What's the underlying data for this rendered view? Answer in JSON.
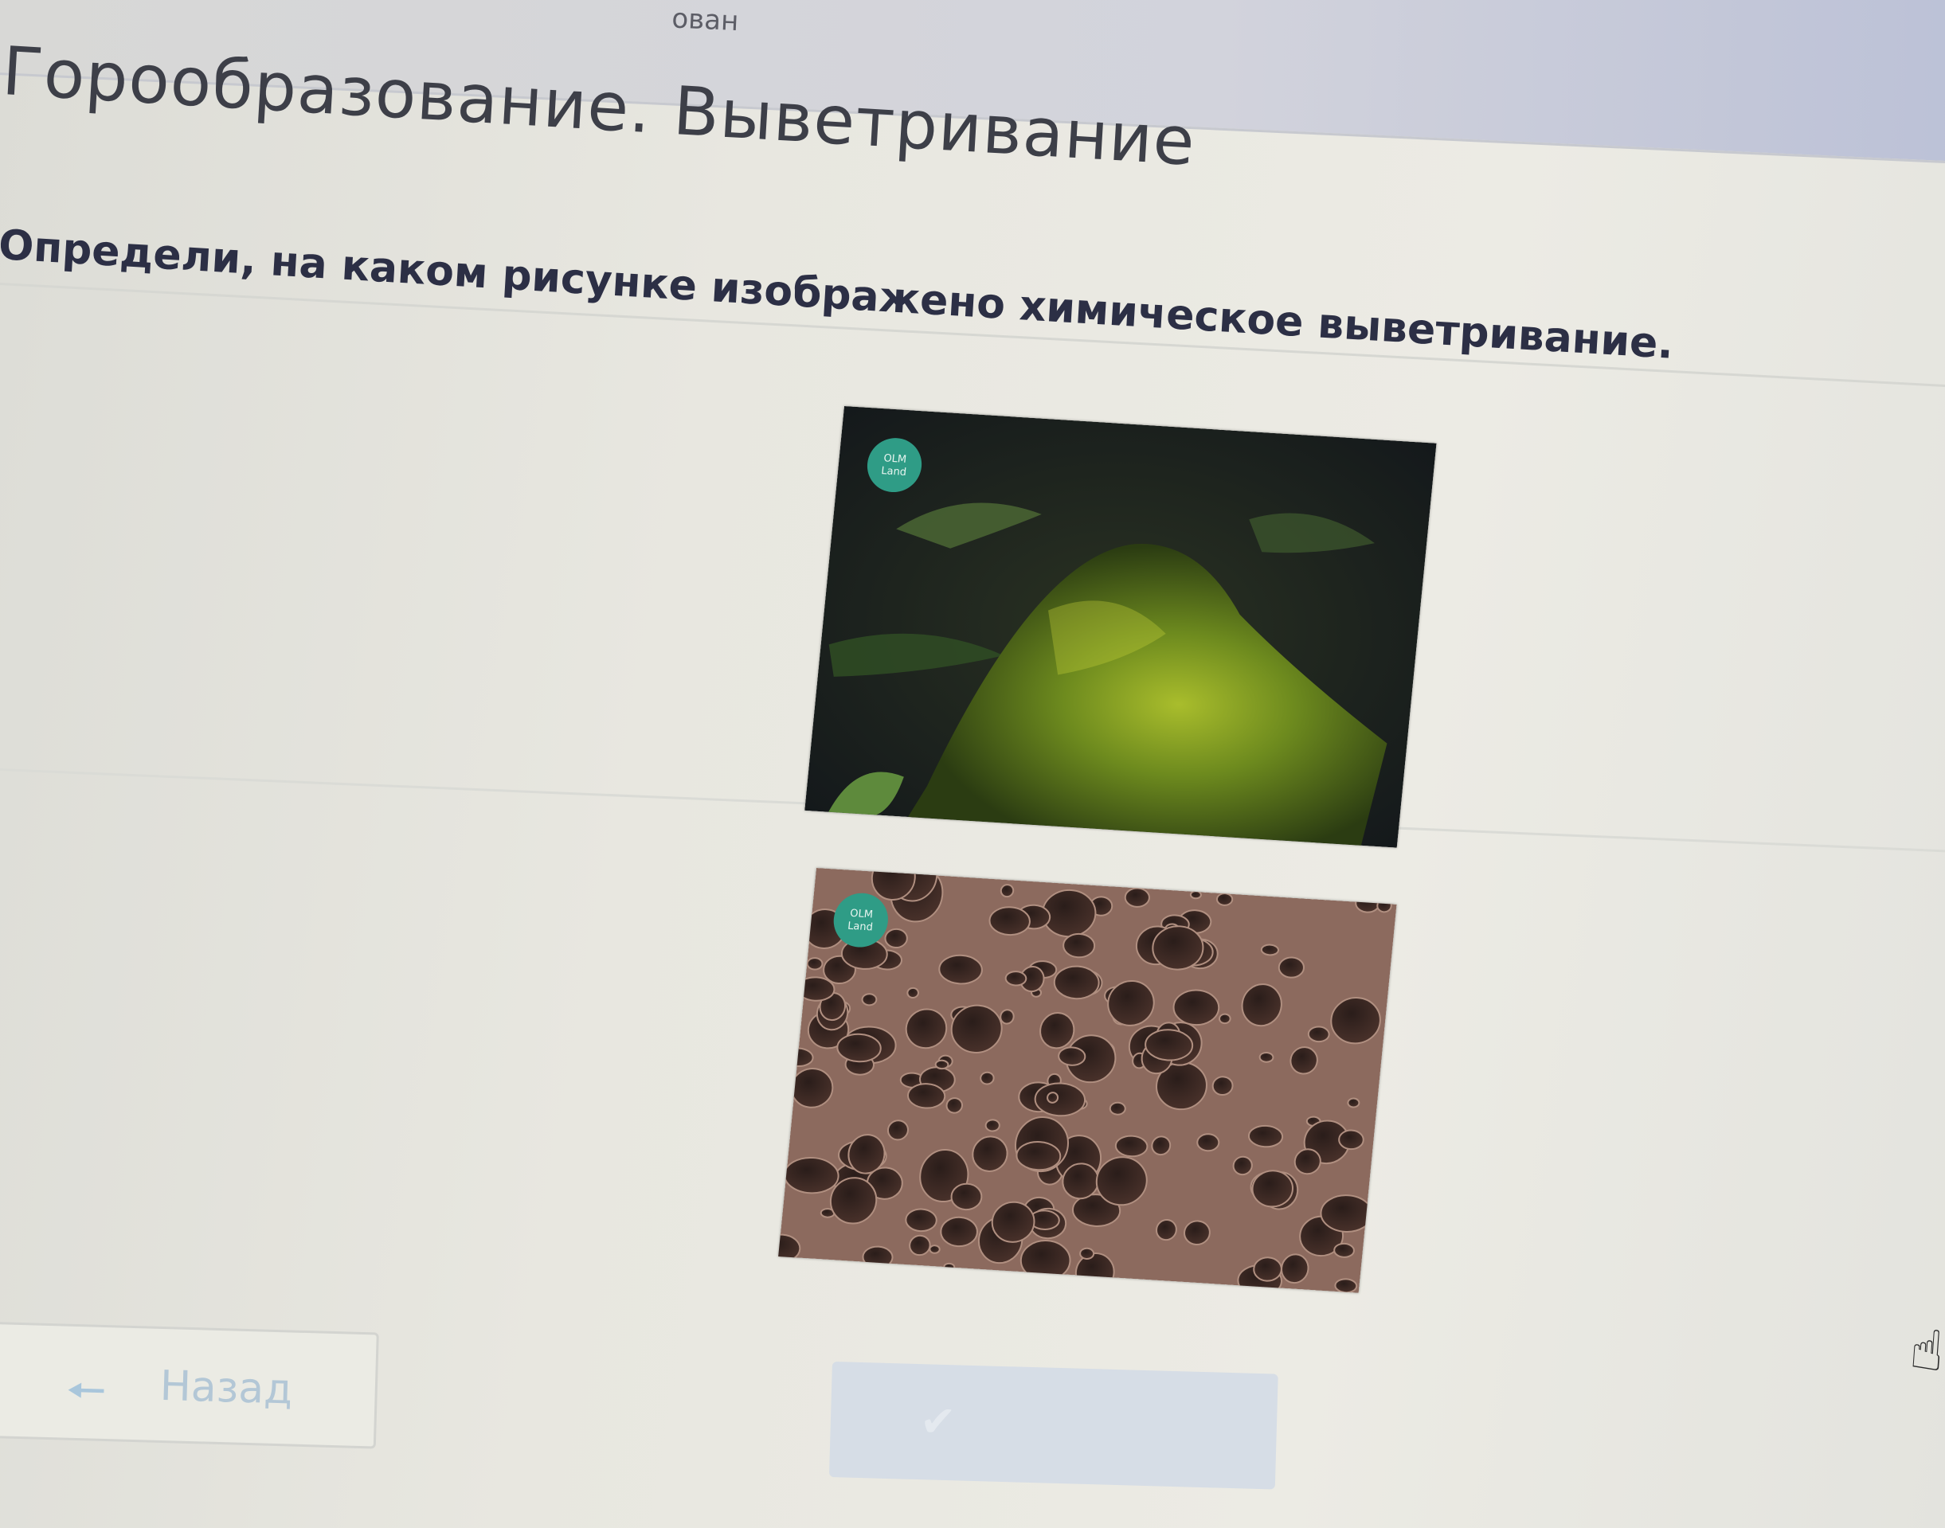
{
  "header": {
    "partial_text": "ован"
  },
  "lesson": {
    "title": "Горообразование. Выветривание"
  },
  "question": {
    "text": "Определи, на каком рисунке изображено химическое выветривание."
  },
  "options": [
    {
      "image": "moss-covered-rock-photo",
      "logo": [
        "OLM",
        "Land"
      ]
    },
    {
      "image": "porous-weathered-rock-photo",
      "logo": [
        "OLM",
        "Land"
      ]
    }
  ],
  "navigation": {
    "back_label": "Назад",
    "back_icon": "arrow-left-icon",
    "check_icon": "checkmark-icon"
  },
  "colors": {
    "accent_disabled": "#b3c7d6",
    "logo_badge": "#2f9c86",
    "title_text": "#3d3f48",
    "question_text": "#2c2f45"
  }
}
